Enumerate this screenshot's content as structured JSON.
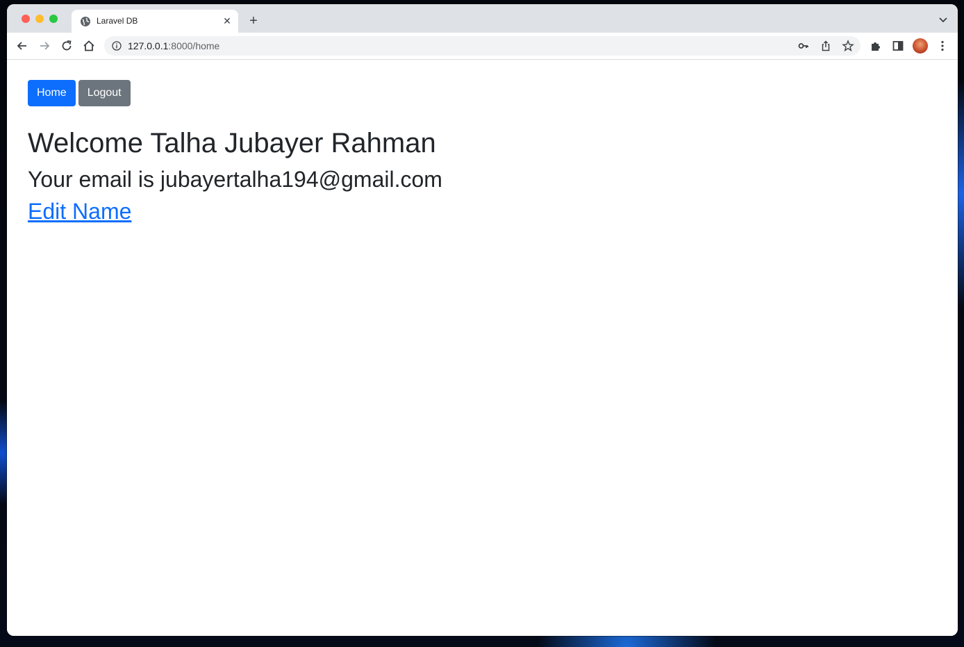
{
  "browser": {
    "tab_title": "Laravel DB",
    "url_host": "127.0.0.1",
    "url_path": ":8000/home"
  },
  "nav": {
    "home_label": "Home",
    "logout_label": "Logout"
  },
  "page": {
    "welcome": "Welcome Talha Jubayer Rahman",
    "email_line": "Your email is jubayertalha194@gmail.com",
    "edit_link": "Edit Name"
  },
  "colors": {
    "primary": "#0d6efd",
    "secondary": "#6c757d",
    "text": "#212529"
  }
}
